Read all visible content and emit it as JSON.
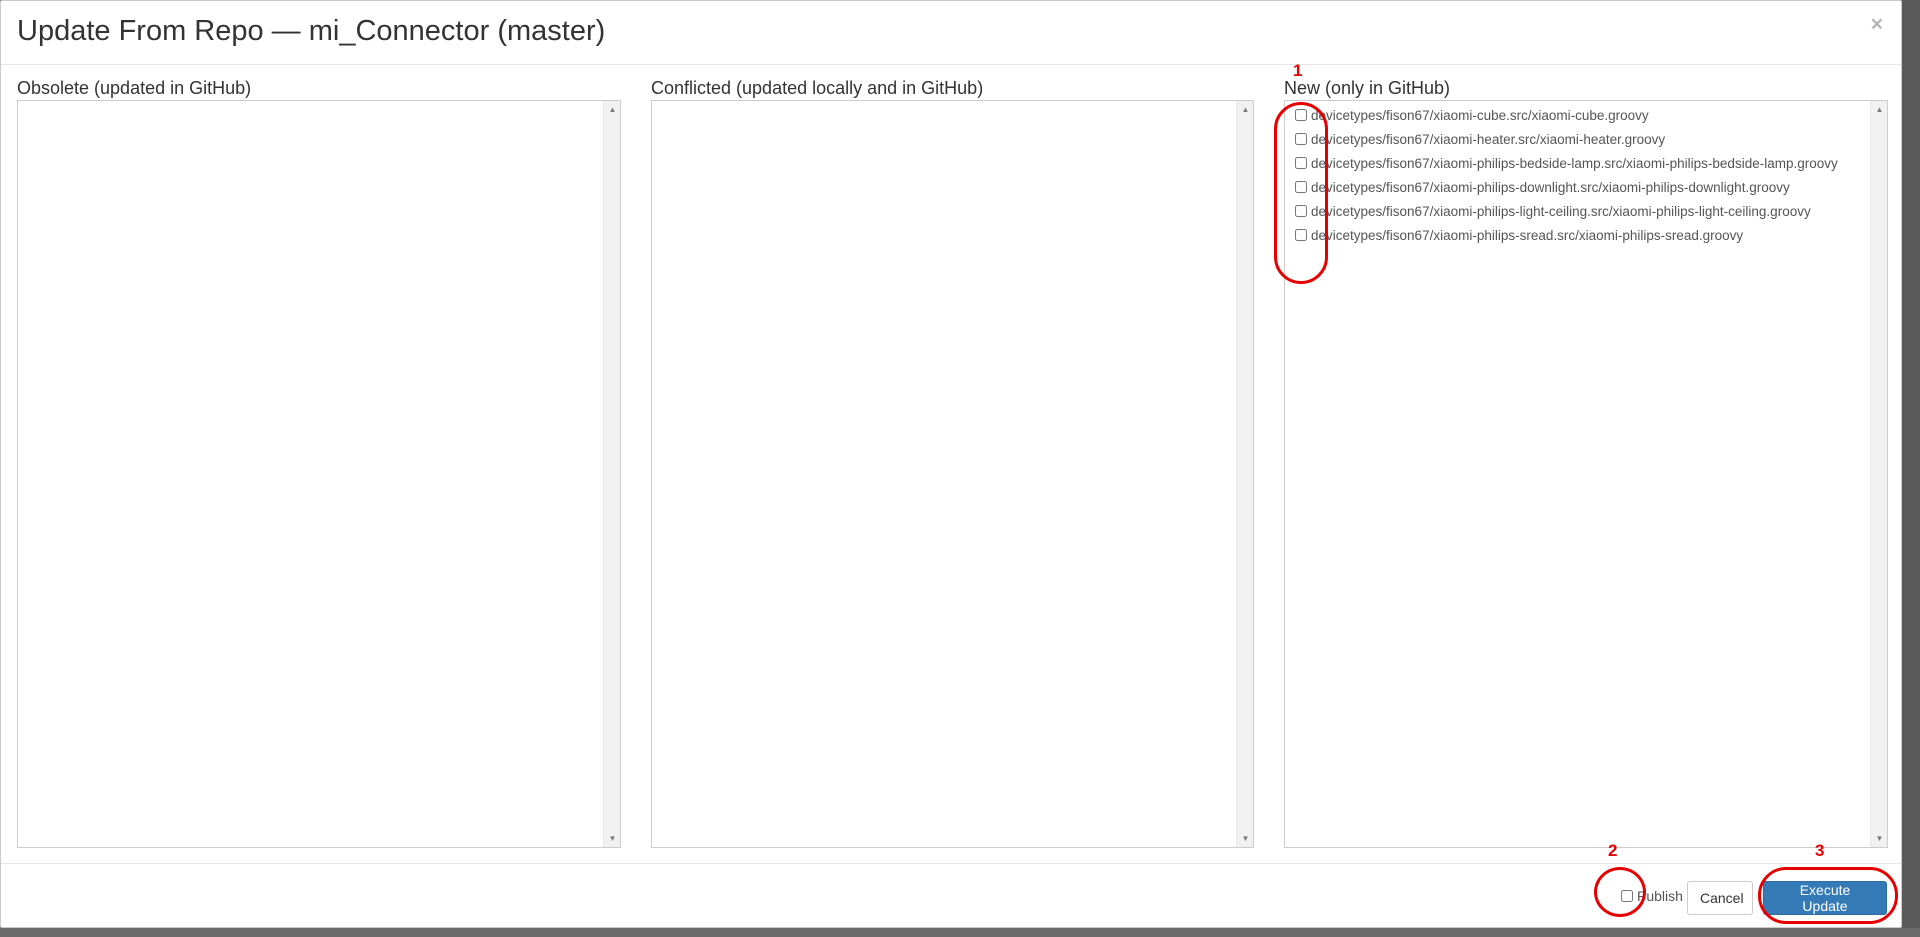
{
  "modal": {
    "title": "Update From Repo — mi_Connector (master)",
    "close_glyph": "×"
  },
  "panels": [
    {
      "label": "Obsolete (updated in GitHub)",
      "items": []
    },
    {
      "label": "Conflicted (updated locally and in GitHub)",
      "items": []
    },
    {
      "label": "New (only in GitHub)",
      "items": [
        "devicetypes/fison67/xiaomi-cube.src/xiaomi-cube.groovy",
        "devicetypes/fison67/xiaomi-heater.src/xiaomi-heater.groovy",
        "devicetypes/fison67/xiaomi-philips-bedside-lamp.src/xiaomi-philips-bedside-lamp.groovy",
        "devicetypes/fison67/xiaomi-philips-downlight.src/xiaomi-philips-downlight.groovy",
        "devicetypes/fison67/xiaomi-philips-light-ceiling.src/xiaomi-philips-light-ceiling.groovy",
        "devicetypes/fison67/xiaomi-philips-sread.src/xiaomi-philips-sread.groovy"
      ]
    }
  ],
  "footer": {
    "publish_label": "Publish",
    "cancel_label": "Cancel",
    "execute_label": "Execute Update"
  },
  "annotations": {
    "n1": "1",
    "n2": "2",
    "n3": "3",
    "color": "#e60000"
  },
  "icons": {
    "scroll_up": "▲",
    "scroll_down": "▼"
  }
}
